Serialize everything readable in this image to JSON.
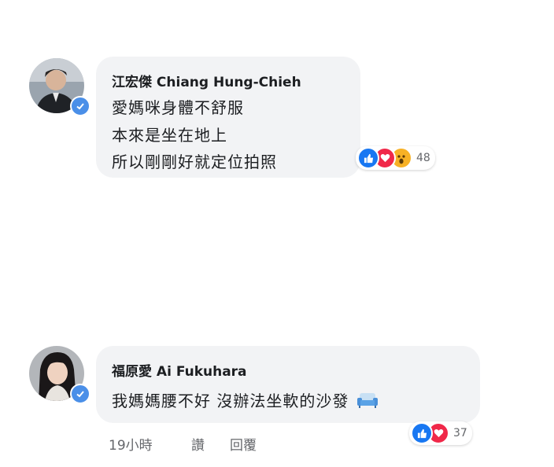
{
  "comments": [
    {
      "author": "江宏傑 Chiang Hung-Chieh",
      "lines": [
        "愛媽咪身體不舒服",
        "本來是坐在地上",
        "所以剛剛好就定位拍照"
      ],
      "reaction_icons": [
        "like-icon",
        "love-icon",
        "wow-icon"
      ],
      "reaction_count": "48"
    },
    {
      "author": "福原愛 Ai Fukuhara",
      "lines": [
        "我媽媽腰不好 沒辦法坐軟的沙發"
      ],
      "inline_icon": "sofa-icon",
      "reaction_icons": [
        "like-icon",
        "love-icon"
      ],
      "reaction_count": "37",
      "meta": {
        "time": "19小時",
        "like": "讚",
        "reply": "回覆"
      }
    }
  ],
  "colors": {
    "bubble": "#f2f3f5",
    "like_blue": "#1877f2",
    "love_red": "#f02849",
    "wow_yellow": "#f7b125",
    "verified_blue": "#4a8fe8"
  }
}
